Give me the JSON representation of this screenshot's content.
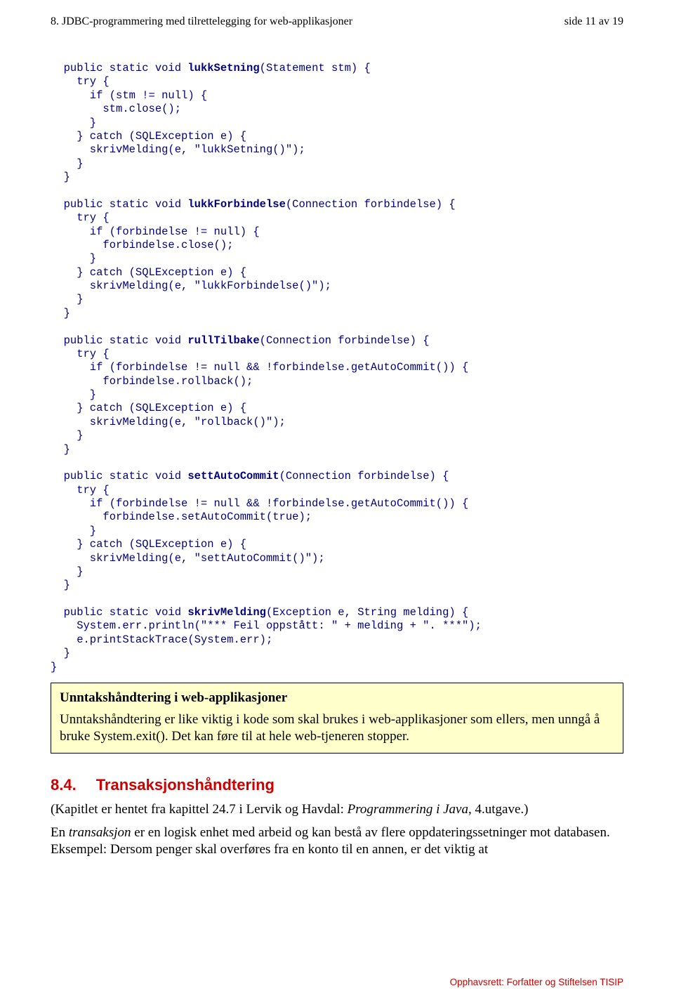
{
  "header": {
    "left": "8. JDBC-programmering med tilrettelegging for web-applikasjoner",
    "right": "side 11 av 19"
  },
  "code": {
    "m1": {
      "sig1": "  public static void ",
      "sig2": "lukkSetning",
      "sig3": "(Statement stm) {",
      "l1": "    try {",
      "l2": "      if (stm != null) {",
      "l3": "        stm.close();",
      "l4": "      }",
      "l5": "    } catch (SQLException e) {",
      "l6": "      skrivMelding(e, \"lukkSetning()\");",
      "l7": "    }",
      "l8": "  }"
    },
    "m2": {
      "sig1": "  public static void ",
      "sig2": "lukkForbindelse",
      "sig3": "(Connection forbindelse) {",
      "l1": "    try {",
      "l2": "      if (forbindelse != null) {",
      "l3": "        forbindelse.close();",
      "l4": "      }",
      "l5": "    } catch (SQLException e) {",
      "l6": "      skrivMelding(e, \"lukkForbindelse()\");",
      "l7": "    }",
      "l8": "  }"
    },
    "m3": {
      "sig1": "  public static void ",
      "sig2": "rullTilbake",
      "sig3": "(Connection forbindelse) {",
      "l1": "    try {",
      "l2": "      if (forbindelse != null && !forbindelse.getAutoCommit()) {",
      "l3": "        forbindelse.rollback();",
      "l4": "      }",
      "l5": "    } catch (SQLException e) {",
      "l6": "      skrivMelding(e, \"rollback()\");",
      "l7": "    }",
      "l8": "  }"
    },
    "m4": {
      "sig1": "  public static void ",
      "sig2": "settAutoCommit",
      "sig3": "(Connection forbindelse) {",
      "l1": "    try {",
      "l2": "      if (forbindelse != null && !forbindelse.getAutoCommit()) {",
      "l3": "        forbindelse.setAutoCommit(true);",
      "l4": "      }",
      "l5": "    } catch (SQLException e) {",
      "l6": "      skrivMelding(e, \"settAutoCommit()\");",
      "l7": "    }",
      "l8": "  }"
    },
    "m5": {
      "sig1": "  public static void ",
      "sig2": "skrivMelding",
      "sig3": "(Exception e, String melding) {",
      "l1": "    System.err.println(\"*** Feil oppstått: \" + melding + \". ***\");",
      "l2": "    e.printStackTrace(System.err);",
      "l3": "  }",
      "l4": "}"
    }
  },
  "info": {
    "title": "Unntakshåndtering i web-applikasjoner",
    "body": "Unntakshåndtering er like viktig i kode som skal brukes i web-applikasjoner som ellers, men unngå å bruke System.exit(). Det kan føre til at hele web-tjeneren stopper."
  },
  "section": {
    "num": "8.4.",
    "title": "Transaksjonshåndtering",
    "p1a": "(Kapitlet er hentet fra kapittel 24.7 i Lervik og Havdal: ",
    "p1i": "Programmering i Java",
    "p1b": ", 4.utgave.)",
    "p2a": "En ",
    "p2i": "transaksjon",
    "p2b": " er en logisk enhet med arbeid og kan bestå av flere oppdateringssetninger mot databasen. Eksempel: Dersom penger skal overføres fra en konto til en annen, er det viktig at"
  },
  "footer": "Opphavsrett:  Forfatter og Stiftelsen TISIP"
}
